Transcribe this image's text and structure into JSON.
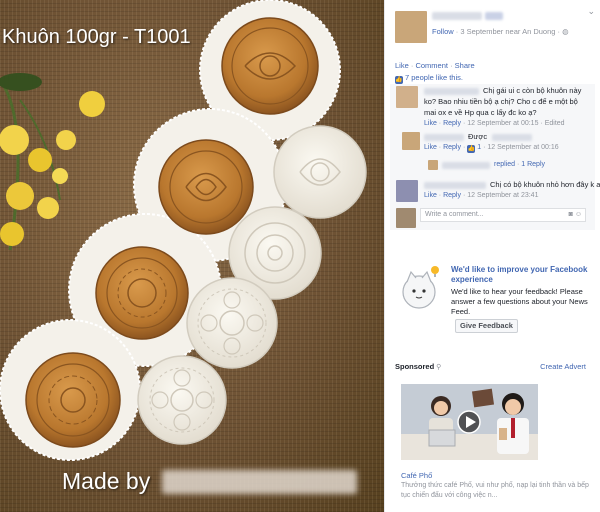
{
  "photo": {
    "caption": "Khuôn 100gr - T1001",
    "made_by": "Made by"
  },
  "post": {
    "follow_label": "Follow",
    "meta": "· 3 September near An Duong ·",
    "actions": [
      "Like",
      "Comment",
      "Share"
    ],
    "likes": "7 people like this."
  },
  "comments": [
    {
      "lines": [
        "Chị gái ui c còn bộ khuôn này",
        "ko? Bao nhiu tiền bộ ạ chị? Cho c để e một bộ",
        "mai ox e về Hp qua c lấy đc ko ạ?"
      ],
      "like": "Like",
      "reply": "Reply",
      "time": "12 September at 00:15",
      "edited": "Edited"
    },
    {
      "lines": [
        "Được"
      ],
      "like": "Like",
      "reply": "Reply",
      "likes": "1",
      "time": "12 September at 00:16"
    },
    {
      "replied": "replied",
      "reply_count": "1 Reply"
    },
    {
      "lines": [
        "Chị có bộ khuôn nhỏ hơn đây k a"
      ],
      "like": "Like",
      "reply": "Reply",
      "time": "12 September at 23:41"
    }
  ],
  "write_comment": "Write a comment...",
  "survey": {
    "title": "We'd like to improve your Facebook experience",
    "body": "We'd like to hear your feedback! Please answer a few questions about your News Feed.",
    "button": "Give Feedback"
  },
  "sponsored": {
    "label": "Sponsored",
    "create_advert": "Create Advert",
    "ad_title": "Café Phố",
    "ad_desc": "Thưởng thức café Phố, vui như phố, nạp lại tinh thần và bếp tục chiến đấu với công việc n..."
  },
  "colors": {
    "link": "#4267b2",
    "muted": "#90949c",
    "comment_bg": "#f6f7f9"
  }
}
